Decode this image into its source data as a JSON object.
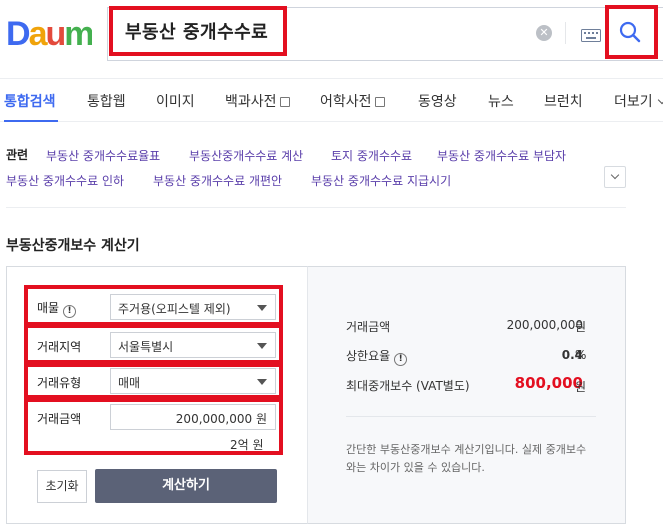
{
  "header": {
    "logo_text": "Daum",
    "search_query": "부동산 중개수수료"
  },
  "tabs": [
    {
      "label": "통합검색"
    },
    {
      "label": "통합웹"
    },
    {
      "label": "이미지"
    },
    {
      "label": "백과사전"
    },
    {
      "label": "어학사전"
    },
    {
      "label": "동영상"
    },
    {
      "label": "뉴스"
    },
    {
      "label": "브런치"
    },
    {
      "label": "더보기"
    }
  ],
  "related": {
    "label": "관련",
    "links": [
      "부동산 중개수수료율표",
      "부동산중개수수료 계산",
      "토지 중개수수료",
      "부동산 중개수수료 부담자",
      "부동산 중개수수료 인하",
      "부동산 중개수수료 개편안",
      "부동산 중개수수료 지급시기"
    ]
  },
  "calculator": {
    "title": "부동산중개보수 계산기",
    "property_label": "매물",
    "property_value": "주거용(오피스텔 제외)",
    "region_label": "거래지역",
    "region_value": "서울특별시",
    "type_label": "거래유형",
    "type_value": "매매",
    "amount_label": "거래금액",
    "amount_value": "200,000,000 원",
    "amount_korean": "2억 원",
    "reset_label": "초기화",
    "calc_label": "계산하기",
    "info_glyph": "!"
  },
  "result": {
    "amount_label": "거래금액",
    "amount_value": "200,000,000",
    "amount_unit": "원",
    "rate_label": "상한요율",
    "rate_value": "0.4",
    "rate_unit": "%",
    "fee_label": "최대중개보수 (VAT별도)",
    "fee_value": "800,000",
    "fee_unit": "원",
    "notice": "간단한 부동산중개보수 계산기입니다. 실제 중개보수와는 차이가 있을 수 있습니다."
  },
  "colors": {
    "accent": "#3e6af0",
    "highlight_red": "#e30f20",
    "fee_red": "#e30f20",
    "calc_button": "#5b6277"
  },
  "icons": [
    "daum-logo",
    "clear-icon",
    "keyboard-icon",
    "search-icon",
    "dictionary-icon",
    "chevron-down-icon",
    "info-icon"
  ]
}
